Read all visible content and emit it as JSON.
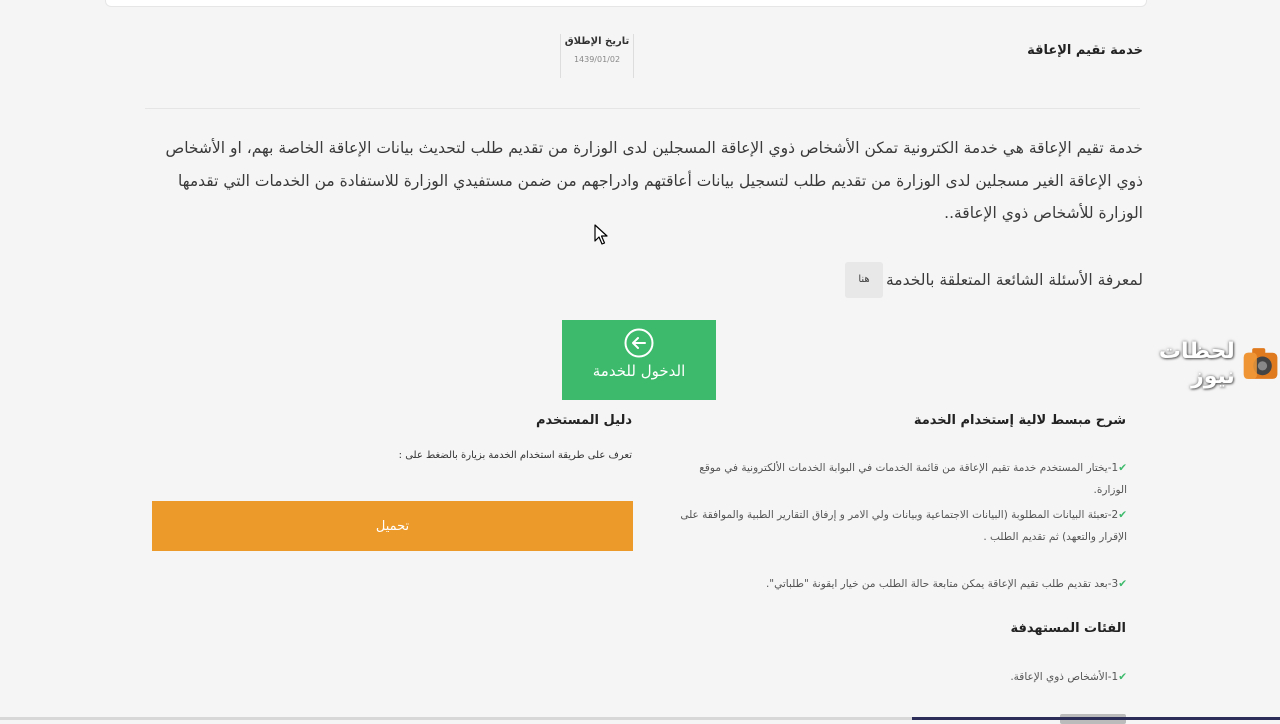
{
  "header": {
    "service_title": "خدمة تقيم الإعاقة",
    "launch_label": "تاريخ الإطلاق",
    "launch_date": "1439/01/02"
  },
  "description": "خدمة تقيم الإعاقة هي خدمة الكترونية تمكن الأشخاص ذوي الإعاقة المسجلين لدى الوزارة من تقديم طلب لتحديث بيانات الإعاقة الخاصة بهم، او الأشخاص ذوي الإعاقة الغير مسجلين لدى الوزارة من تقديم طلب لتسجيل بيانات أعاقتهم وادراجهم من ضمن مستفيدي الوزارة للاستفادة من الخدمات التي تقدمها الوزارة للأشخاص ذوي الإعاقة..",
  "faq": {
    "text": "لمعرفة الأسئلة الشائعة المتعلقة بالخدمة",
    "link_label": "هنا"
  },
  "enter_button": {
    "label": "الدخول للخدمة",
    "icon": "arrow-left-circle-icon",
    "color": "#3dba6b"
  },
  "watermark": {
    "text": "لحظات نيوز",
    "icon": "camera-logo-icon"
  },
  "guide": {
    "title": "دليل المستخدم",
    "text": "تعرف على طريقة استخدام الخدمة بزيارة بالضغط على :",
    "download_label": "تحميل",
    "download_color": "#ec9a2a"
  },
  "howto": {
    "title": "شرح مبسط لالية إستخدام الخدمة",
    "steps": [
      "1-يختار المستخدم خدمة تقيم الإعاقة من قائمة الخدمات في البوابة الخدمات الألكترونية في موقع الوزارة.",
      "2-تعبئة البيانات المطلوبة (البيانات الاجتماعية وبيانات ولي الامر و إرفاق التقارير الطبية والموافقة على الإقرار والتعهد) ثم تقديم الطلب .",
      "3-بعد تقديم طلب تقيم الإعاقة يمكن متابعة حالة الطلب من خيار ايقونة \"طلباتي\"."
    ]
  },
  "targets": {
    "title": "الفئات المستهدفة",
    "items": [
      "1-الأشخاص ذوي الإعاقة."
    ]
  }
}
